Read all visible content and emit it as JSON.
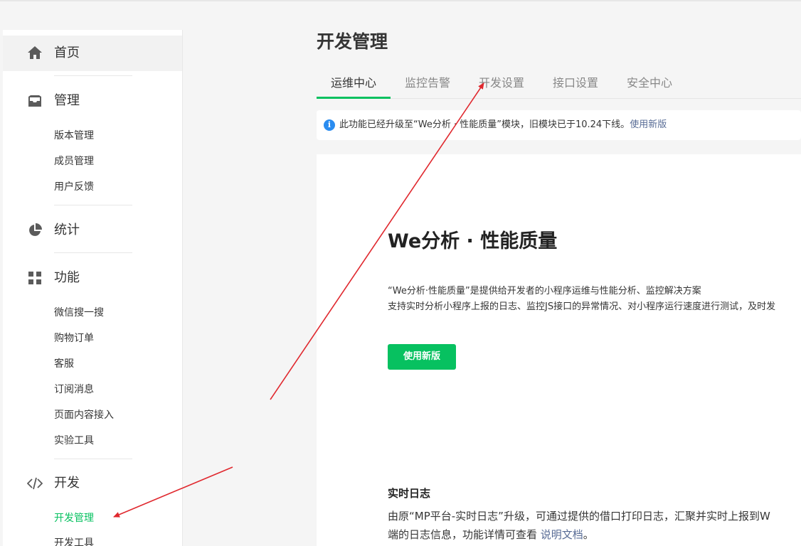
{
  "sidebar": {
    "home": "首页",
    "manage": {
      "title": "管理",
      "items": [
        "版本管理",
        "成员管理",
        "用户反馈"
      ]
    },
    "stats": {
      "title": "统计"
    },
    "features": {
      "title": "功能",
      "items": [
        "微信搜一搜",
        "购物订单",
        "客服",
        "订阅消息",
        "页面内容接入",
        "实验工具"
      ]
    },
    "dev": {
      "title": "开发",
      "items": [
        "开发管理",
        "开发工具"
      ]
    }
  },
  "main": {
    "title": "开发管理",
    "tabs": [
      "运维中心",
      "监控告警",
      "开发设置",
      "接口设置",
      "安全中心"
    ],
    "notice": {
      "text": "此功能已经升级至“We分析 · 性能质量”模块，旧模块已于10.24下线。",
      "link": "使用新版"
    },
    "card": {
      "title": "We分析 · 性能质量",
      "desc1": "“We分析·性能质量”是提供给开发者的小程序运维与性能分析、监控解决方案",
      "desc2": "支持实时分析小程序上报的日志、监控JS接口的异常情况、对小程序运行速度进行测试，及时发",
      "button": "使用新版",
      "log_title": "实时日志",
      "log_desc1": "由原“MP平台-实时日志”升级，可通过提供的借口打印日志，汇聚并实时上报到W",
      "log_desc2": "端的日志信息，功能详情可查看 ",
      "log_link": "说明文档",
      "log_end": "。"
    }
  },
  "colors": {
    "accent": "#07c160",
    "link": "#576b95",
    "info": "#2a8cf0",
    "arrow": "#e0282e"
  }
}
